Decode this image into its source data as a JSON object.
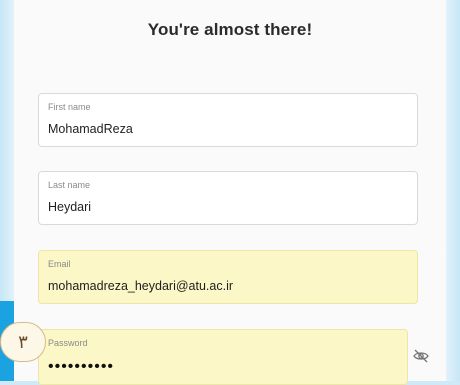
{
  "form": {
    "title": "You're almost there!",
    "fields": {
      "first_name": {
        "label": "First name",
        "value": "MohamadReza"
      },
      "last_name": {
        "label": "Last name",
        "value": "Heydari"
      },
      "email": {
        "label": "Email",
        "value": "mohamadreza_heydari@atu.ac.ir"
      },
      "password": {
        "label": "Password",
        "value": "••••••••••"
      }
    },
    "password_toggle_icon": "eye-slash-icon"
  },
  "step_badge": {
    "text": "۳"
  },
  "colors": {
    "background": "#bfe3f5",
    "card": "#fafafa",
    "autofill": "#fbf7c6",
    "badge_border": "#d8b98a"
  }
}
